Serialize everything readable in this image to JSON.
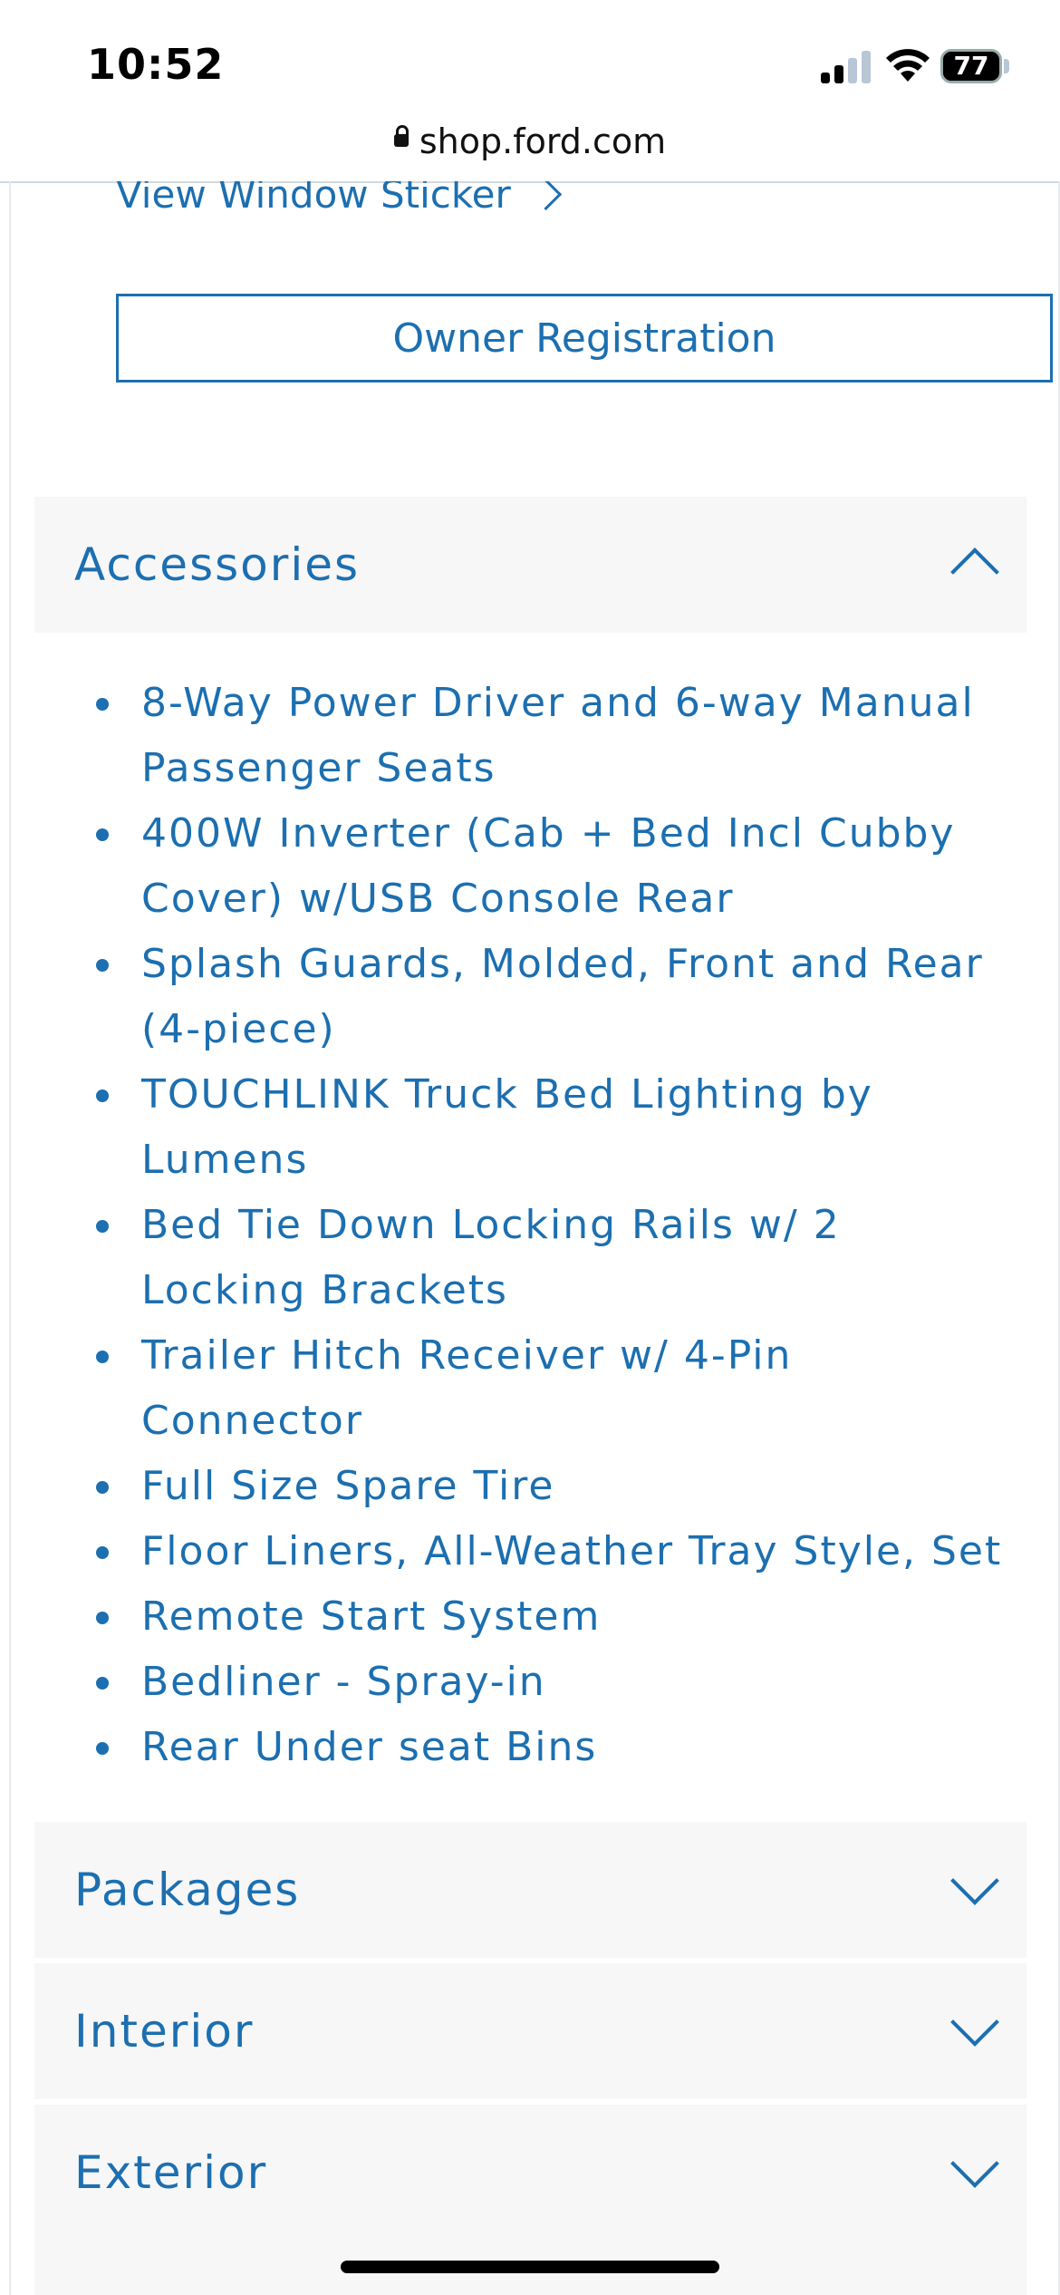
{
  "status_bar": {
    "time": "10:52",
    "battery": "77",
    "battery_level_pct": 77,
    "signal_bars": 2
  },
  "url_bar": {
    "url": "shop.ford.com"
  },
  "links": {
    "window_sticker": "View Window Sticker"
  },
  "buttons": {
    "owner_registration": "Owner Registration"
  },
  "sections": {
    "accessories": {
      "title": "Accessories",
      "expanded": true
    },
    "packages": {
      "title": "Packages",
      "expanded": false
    },
    "interior": {
      "title": "Interior",
      "expanded": false
    },
    "exterior": {
      "title": "Exterior",
      "expanded": false
    }
  },
  "accessories_items": [
    "8-Way Power Driver and 6-way Manual Passenger Seats",
    "400W Inverter (Cab + Bed Incl Cubby Cover) w/USB Console Rear",
    "Splash Guards, Molded, Front and Rear (4-piece)",
    "TOUCHLINK Truck Bed Lighting by Lumens",
    "Bed Tie Down Locking Rails w/ 2 Locking Brackets",
    "Trailer Hitch Receiver w/ 4-Pin Connector",
    "Full Size Spare Tire",
    "Floor Liners, All-Weather Tray Style, Set",
    "Remote Start System",
    "Bedliner - Spray-in",
    "Rear Under seat Bins"
  ],
  "colors": {
    "accent": "#1c6fb0",
    "section_bg": "#f7f7f7"
  }
}
